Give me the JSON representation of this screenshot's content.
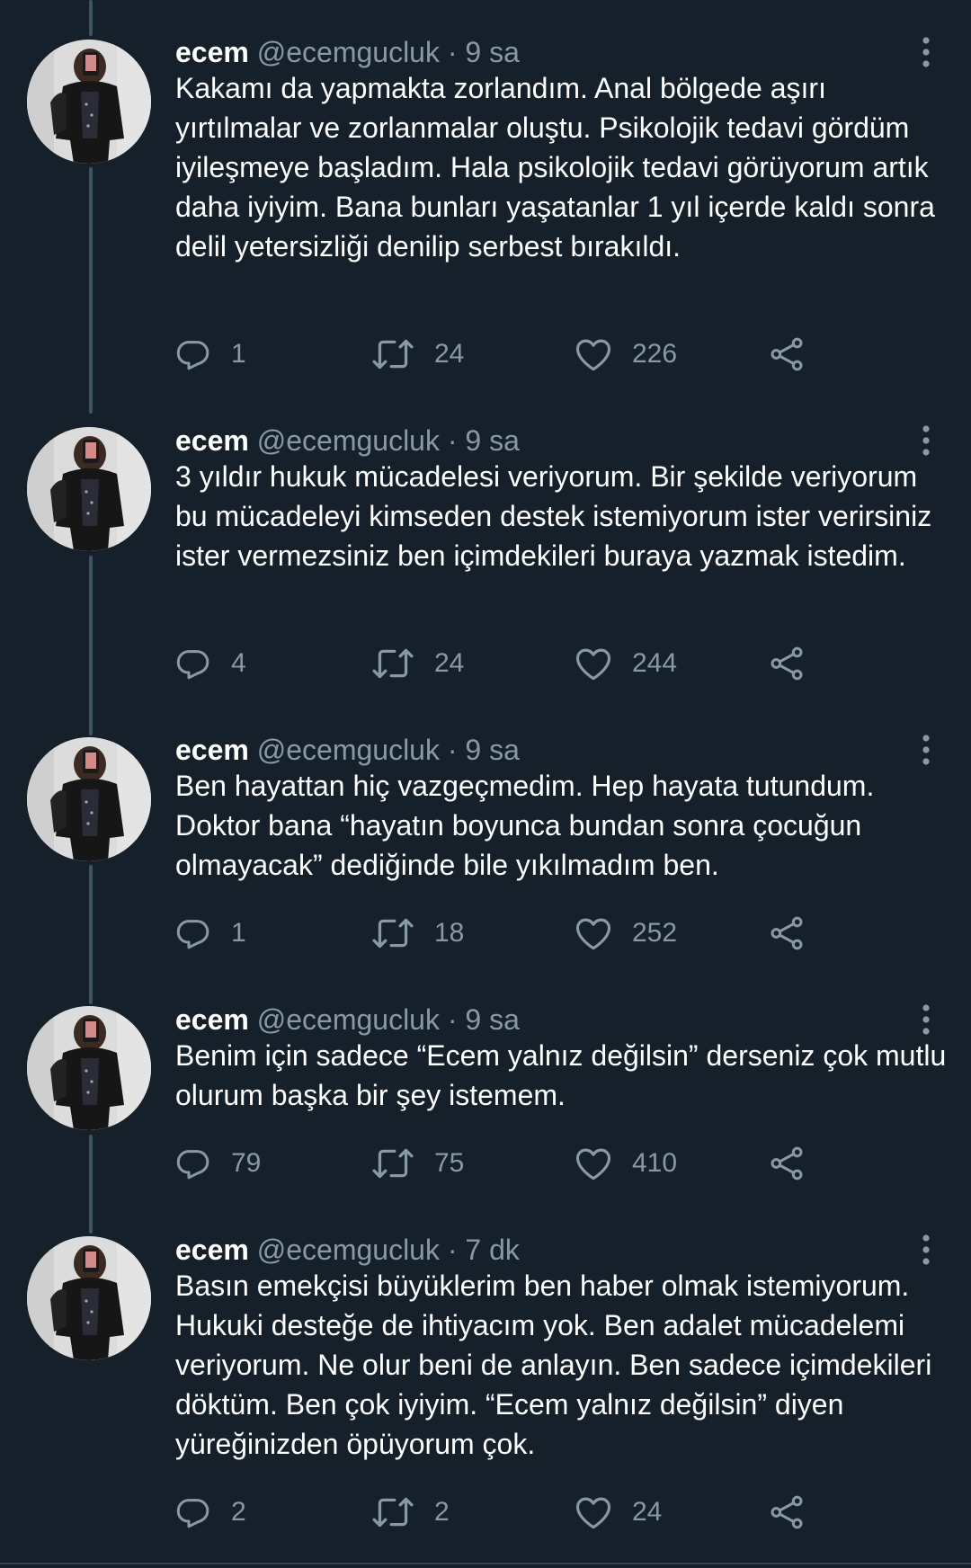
{
  "tweets": [
    {
      "name": "ecem",
      "handle": "@ecemgucluk",
      "separator": "·",
      "time": "9 sa",
      "text": "Kakamı da yapmakta zorlandım. Anal bölgede aşırı yırtılmalar ve zorlanmalar oluştu. Psikolojik tedavi gördüm iyileşmeye başladım. Hala psikolojik tedavi görüyorum artık daha iyiyim. Bana bunları yaşatanlar 1 yıl içerde kaldı sonra delil yetersizliği denilip serbest bırakıldı.",
      "replies": "1",
      "retweets": "24",
      "likes": "226"
    },
    {
      "name": "ecem",
      "handle": "@ecemgucluk",
      "separator": "·",
      "time": "9 sa",
      "text": "3 yıldır hukuk mücadelesi veriyorum. Bir şekilde veriyorum bu mücadeleyi kimseden destek istemiyorum ister verirsiniz ister vermezsiniz ben içimdekileri buraya yazmak istedim.",
      "replies": "4",
      "retweets": "24",
      "likes": "244"
    },
    {
      "name": "ecem",
      "handle": "@ecemgucluk",
      "separator": "·",
      "time": "9 sa",
      "text": "Ben hayattan hiç vazgeçmedim. Hep hayata tutundum. Doktor bana “hayatın boyunca bundan sonra çocuğun olmayacak” dediğinde bile yıkılmadım ben.",
      "replies": "1",
      "retweets": "18",
      "likes": "252"
    },
    {
      "name": "ecem",
      "handle": "@ecemgucluk",
      "separator": "·",
      "time": "9 sa",
      "text": "Benim için sadece “Ecem yalnız değilsin” derseniz çok mutlu olurum başka bir şey istemem.",
      "replies": "79",
      "retweets": "75",
      "likes": "410"
    },
    {
      "name": "ecem",
      "handle": "@ecemgucluk",
      "separator": "·",
      "time": "7 dk",
      "text": "Basın emekçisi büyüklerim ben haber olmak istemiyorum. Hukuki desteğe de ihtiyacım yok. Ben adalet mücadelemi veriyorum. Ne olur beni de anlayın. Ben sadece içimdekileri döktüm. Ben çok iyiyim. “Ecem yalnız değilsin” diyen yüreğinizden öpüyorum çok.",
      "replies": "2",
      "retweets": "2",
      "likes": "24"
    }
  ],
  "icons": {
    "reply": "reply-icon",
    "retweet": "retweet-icon",
    "like": "heart-icon",
    "share": "share-icon",
    "more": "more-vertical-icon"
  },
  "colors": {
    "background": "#15202b",
    "secondary_text": "#8899a6",
    "thread_line": "#3d5466"
  }
}
